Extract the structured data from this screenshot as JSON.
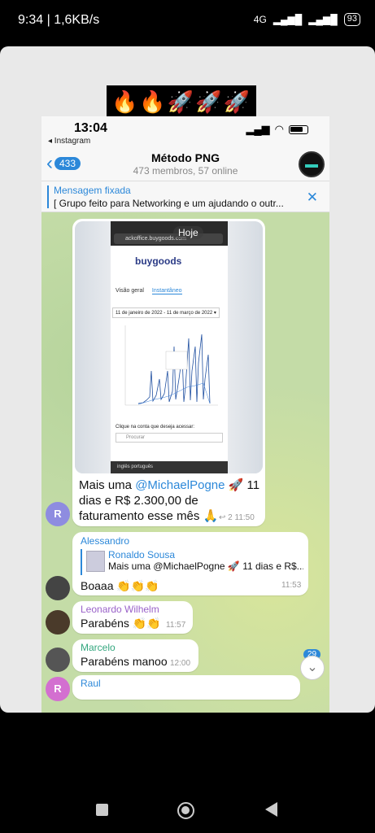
{
  "outer_status": {
    "time_speed": "9:34 | 1,6KB/s",
    "network": "4G",
    "battery": "93"
  },
  "banner": {
    "emojis": "🔥🔥🚀🚀🚀"
  },
  "ios_status": {
    "time": "13:04",
    "back_app": "◂ Instagram"
  },
  "header": {
    "back_count": "433",
    "title": "Método PNG",
    "subtitle": "473 membros, 57 online"
  },
  "pinned": {
    "label": "Mensagem fixada",
    "text": "[ Grupo feito para Networking e um ajudando o outr..."
  },
  "media_message": {
    "date_badge": "Hoje",
    "screenshot": {
      "url": "ackoffice.buygoods.com",
      "logo": "buygoods",
      "tab1": "Visão geral",
      "tab2": "Instantâneo",
      "date_range": "11 de janeiro de 2022 - 11 de março de 2022 ▾",
      "pick_label": "Clique na conta que deseja acessar:",
      "search_placeholder": "Procurar",
      "bottom_lang": "inglês   português"
    },
    "caption_pre": "Mais uma ",
    "caption_mention": "@MichaelPogne",
    "caption_post": " 🚀 11 dias e R$ 2.300,00 de faturamento esse mês 🙏",
    "meta": "↩ 2  11:50",
    "avatar_letter": "R"
  },
  "messages": [
    {
      "sender": "Alessandro",
      "quote_name": "Ronaldo Sousa",
      "quote_text": "Mais uma @MichaelPogne 🚀 11 dias e R$...",
      "text": "Boaaa 👏👏👏",
      "time": "11:53"
    },
    {
      "sender": "Leonardo Wilhelm",
      "text": "Parabéns 👏👏",
      "time": "11:57"
    },
    {
      "sender": "Marcelo",
      "text": "Parabéns manoo",
      "time": "12:00"
    },
    {
      "sender": "Raul",
      "avatar_letter": "R"
    }
  ],
  "scroll_badge": "29",
  "colors": {
    "accent": "#2c88d9",
    "chat_bg": "#c4dca7"
  }
}
